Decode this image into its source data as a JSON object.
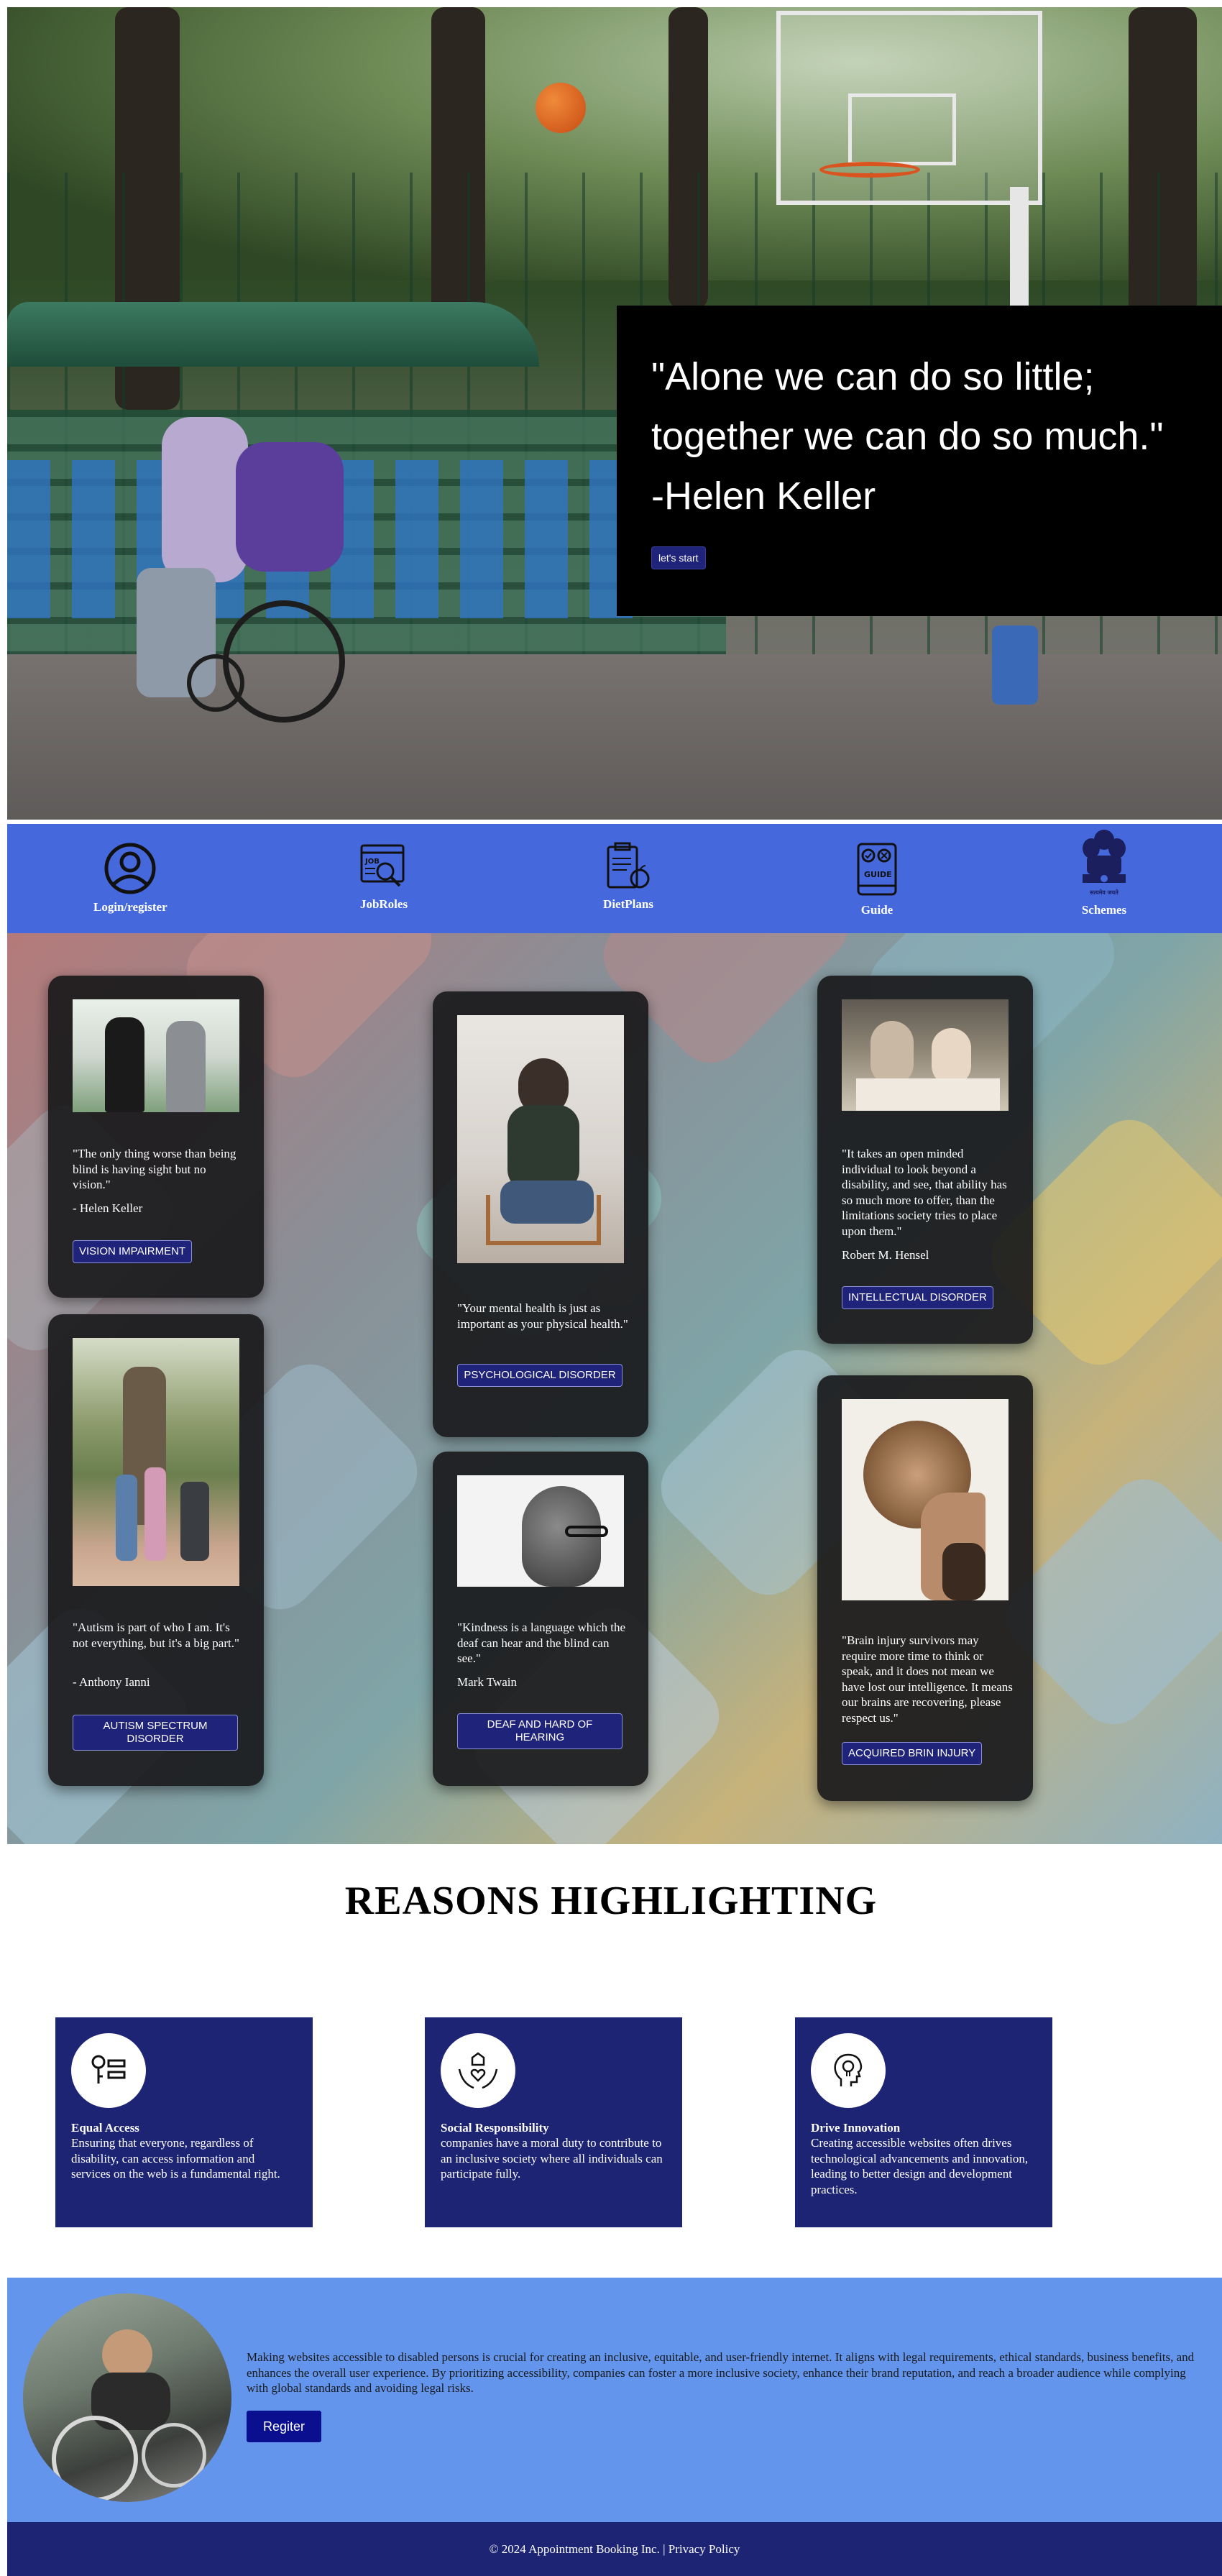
{
  "hero": {
    "quote_line1": "\"Alone we can do so little;",
    "quote_line2": "together we can do so much.\"",
    "author": "-Helen Keller",
    "start_button": "let's start"
  },
  "nav": {
    "items": [
      {
        "label": "Login/register",
        "icon": "user-circle-icon"
      },
      {
        "label": "JobRoles",
        "icon": "job-search-icon"
      },
      {
        "label": "DietPlans",
        "icon": "clipboard-apple-icon"
      },
      {
        "label": "Guide",
        "icon": "guide-book-icon"
      },
      {
        "label": "Schemes",
        "icon": "national-emblem-icon"
      }
    ],
    "emblem_caption": "सत्यमेव जयते"
  },
  "cards": {
    "vision": {
      "quote": "\"The only thing worse than being blind is having sight but no vision.\"",
      "author": "- Helen Keller",
      "button": "VISION IMPAIRMENT"
    },
    "autism": {
      "quote": "\"Autism is part of who I am. It's not everything, but it's a big part.\"",
      "author": "- Anthony Ianni",
      "button": "AUTISM SPECTRUM DISORDER"
    },
    "mental": {
      "quote": "\"Your mental health is just as important as your physical health.\"",
      "button": "PSYCHOLOGICAL DISORDER"
    },
    "deaf": {
      "quote": "\"Kindness is a language which the deaf can hear and the blind can see.\"",
      "author": "Mark Twain",
      "button": "DEAF AND HARD OF HEARING"
    },
    "intellectual": {
      "quote": "\"It takes an open minded individual to look beyond a disability, and see, that ability has so much more to offer, than the limitations society tries to place upon them.\"",
      "author": "Robert M. Hensel",
      "button": "INTELLECTUAL DISORDER"
    },
    "brain": {
      "quote": "\"Brain injury survivors may require more time to think or speak, and it does not mean we have lost our intelligence. It means our brains are recovering, please respect us.\"",
      "button": "ACQUIRED BRIN INJURY"
    }
  },
  "reasons": {
    "title": "REASONS HIGHLIGHTING",
    "items": [
      {
        "title": "Equal Access",
        "text": "Ensuring that everyone, regardless of disability, can access information and services on the web is a fundamental right.",
        "icon": "key-list-icon"
      },
      {
        "title": "Social Responsibility",
        "text": "companies have a moral duty to contribute to an inclusive society where all individuals can participate fully.",
        "icon": "hands-heart-icon"
      },
      {
        "title": "Drive Innovation",
        "text": "Creating accessible websites often drives technological advancements and innovation, leading to better design and development practices.",
        "icon": "lightbulb-head-icon"
      }
    ]
  },
  "about": {
    "text": "Making websites accessible to disabled persons is crucial for creating an inclusive, equitable, and user-friendly internet. It aligns with legal requirements, ethical standards, business benefits, and enhances the overall user experience. By prioritizing accessibility, companies can foster a more inclusive society, enhance their brand reputation, and reach a broader audience while complying with global standards and avoiding legal risks.",
    "register_button": "Regiter"
  },
  "footer": {
    "text": "© 2024 Appointment Booking Inc. | Privacy Policy"
  },
  "colors": {
    "nav_bg": "#4568dc",
    "button_bg": "#1f237a",
    "reason_bg": "#1d2474",
    "about_bg": "#6495ed",
    "footer_bg": "#1d2474"
  }
}
